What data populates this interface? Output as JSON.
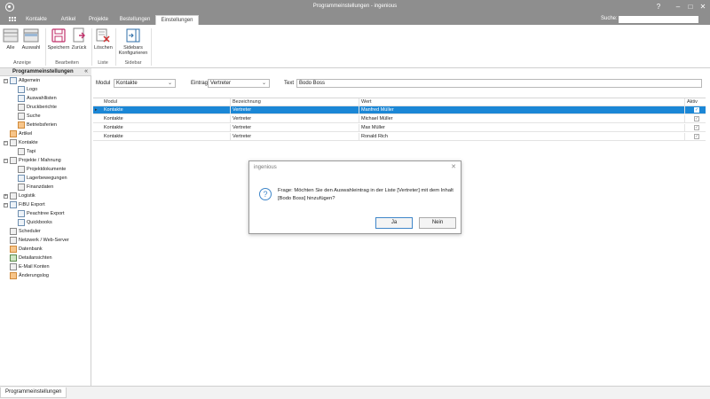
{
  "window": {
    "title": "Programmeinstellungen - ingenious"
  },
  "tabs": [
    {
      "label": "Kontakte"
    },
    {
      "label": "Artikel"
    },
    {
      "label": "Projekte"
    },
    {
      "label": "Bestellungen"
    },
    {
      "label": "Einstellungen"
    }
  ],
  "search": {
    "label": "Suche:",
    "placeholder": ""
  },
  "ribbon": {
    "buttons": {
      "alle": "Alle",
      "auswahl": "Auswahl",
      "speichern": "Speichern",
      "zurueck": "Zurück",
      "loeschen": "Löschen",
      "sidebar_line1": "Sidebars",
      "sidebar_line2": "Konfigurieren"
    },
    "groups": {
      "anzeige": "Anzeige",
      "bearbeiten": "Bearbeiten",
      "liste": "Liste",
      "sidebar": "Sidebar"
    }
  },
  "sidebar": {
    "title": "Programmeinstellungen",
    "items": [
      {
        "label": "Allgemein",
        "icon": "settings-window-icon"
      },
      {
        "label": "Logo",
        "icon": "image-icon"
      },
      {
        "label": "Auswahllisten",
        "icon": "list-icon"
      },
      {
        "label": "Druckberichte",
        "icon": "printer-icon"
      },
      {
        "label": "Suche",
        "icon": "binoculars-icon"
      },
      {
        "label": "Betriebsferien",
        "icon": "vacation-icon"
      },
      {
        "label": "Artikel",
        "icon": "article-icon"
      },
      {
        "label": "Kontakte",
        "icon": "contacts-icon"
      },
      {
        "label": "Tapi",
        "icon": "phone-icon"
      },
      {
        "label": "Projekte / Mahnung",
        "icon": "document-icon"
      },
      {
        "label": "Projektdokumente",
        "icon": "project-docs-icon"
      },
      {
        "label": "Lagerbewegungen",
        "icon": "stock-icon"
      },
      {
        "label": "Finanzdaten",
        "icon": "finance-icon"
      },
      {
        "label": "Logistik",
        "icon": "logistics-icon"
      },
      {
        "label": "FiBU Export",
        "icon": "export-icon"
      },
      {
        "label": "Peachtree Export",
        "icon": "peachtree-icon"
      },
      {
        "label": "Quickbooks",
        "icon": "quickbooks-icon"
      },
      {
        "label": "Scheduler",
        "icon": "scheduler-icon"
      },
      {
        "label": "Netzwerk / Web-Server",
        "icon": "network-icon"
      },
      {
        "label": "Datenbank",
        "icon": "database-icon"
      },
      {
        "label": "Detailansichten",
        "icon": "detail-view-icon"
      },
      {
        "label": "E-Mail Konten",
        "icon": "email-icon"
      },
      {
        "label": "Änderungslog",
        "icon": "changelog-icon"
      }
    ]
  },
  "filters": {
    "modul_label": "Modul",
    "modul_value": "Kontakte",
    "eintrag_label": "Eintrag",
    "eintrag_value": "Vertreter",
    "text_label": "Text",
    "text_value": "Bodo Boss"
  },
  "grid": {
    "columns": [
      "Modul",
      "Bezeichnung",
      "Wert",
      "Aktiv"
    ],
    "rows": [
      {
        "modul": "Kontakte",
        "bezeichnung": "Vertreter",
        "wert": "Manfred Müller",
        "aktiv": true
      },
      {
        "modul": "Kontakte",
        "bezeichnung": "Vertreter",
        "wert": "Michael Müller",
        "aktiv": true
      },
      {
        "modul": "Kontakte",
        "bezeichnung": "Vertreter",
        "wert": "Max Müller",
        "aktiv": true
      },
      {
        "modul": "Kontakte",
        "bezeichnung": "Vertreter",
        "wert": "Ronald Rich",
        "aktiv": true
      }
    ]
  },
  "dialog": {
    "title": "ingenious",
    "message": "Frage: Möchten Sie den Auswahleintrag in der Liste [Vertreter] mit dem Inhalt [Bodo Boss] hinzufügen?",
    "yes": "Ja",
    "no": "Nein"
  },
  "statusbar": {
    "tab": "Programmeinstellungen"
  },
  "colors": {
    "selection": "#1b87d6",
    "titlebar": "#8e8e8e"
  }
}
